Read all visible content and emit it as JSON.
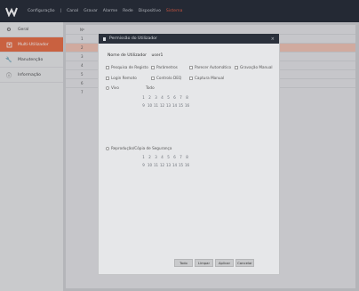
{
  "topbar": {
    "nav": [
      "Configuração",
      "Canal",
      "Gravar",
      "Alarme",
      "Rede",
      "Dispositivo",
      "Sistema"
    ],
    "active_index": 6,
    "colors": {
      "active": "#e2583e",
      "bar": "#1f2530"
    }
  },
  "sidebar": {
    "items": [
      {
        "label": "Geral",
        "icon": "gear-icon"
      },
      {
        "label": "Multi-Utilizador",
        "icon": "user-icon"
      },
      {
        "label": "Manutenção",
        "icon": "wrench-icon"
      },
      {
        "label": "Informação",
        "icon": "info-icon"
      }
    ],
    "active_index": 1
  },
  "main": {
    "header": "Nº",
    "rows": [
      "1",
      "2",
      "3",
      "4",
      "5",
      "6",
      "7"
    ],
    "selected_index": 1
  },
  "dialog": {
    "title": "Permissão do Utilizador",
    "user_label": "Nome de Utilizador",
    "user_value": "user1",
    "perms_row1": [
      "Pesquisa de Registo",
      "Parâmetros",
      "Parecer Automático",
      "Gravação Manual"
    ],
    "perms_row2": [
      "Login Remoto",
      "Controlo DEQ",
      "Captura Manual"
    ],
    "live_label": "Vivo",
    "all_label": "Todo",
    "playback_label": "Reprodução/Cópia de Segurança",
    "channels_row1": [
      "1",
      "2",
      "3",
      "4",
      "5",
      "6",
      "7",
      "8"
    ],
    "channels_row2": [
      "9",
      "10",
      "11",
      "12",
      "13",
      "14",
      "15",
      "16"
    ],
    "buttons": [
      "Todo",
      "Limpar",
      "Aplicar",
      "Cancelar"
    ]
  }
}
